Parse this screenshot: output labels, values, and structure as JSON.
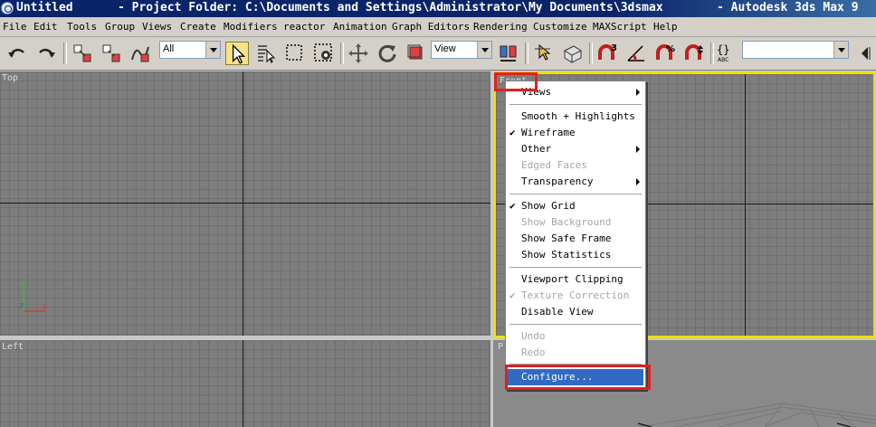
{
  "window": {
    "title_doc": "Untitled",
    "title_project": "- Project Folder: C:\\Documents and Settings\\Administrator\\My Documents\\3dsmax",
    "title_app": "- Autodesk 3ds Max 9"
  },
  "menubar": {
    "items": [
      "File",
      "Edit",
      "Tools",
      "Group",
      "Views",
      "Create",
      "Modifiers",
      "reactor",
      "Animation",
      "Graph Editors",
      "Rendering",
      "Customize",
      "MAXScript",
      "Help"
    ]
  },
  "toolbar": {
    "selection_filter": "All",
    "reference_coord": "View",
    "named_selection": ""
  },
  "viewports": {
    "top_left": "Top",
    "top_right": "Front",
    "bottom_left": "Left",
    "bottom_right": "P"
  },
  "axis_gizmo": {
    "y": "y",
    "z": "z",
    "x": "x"
  },
  "context_menu": {
    "items": [
      {
        "label": "Views",
        "submenu": true,
        "checked": false,
        "disabled": false
      },
      {
        "label": "Smooth + Highlights",
        "submenu": false,
        "checked": false,
        "disabled": false
      },
      {
        "label": "Wireframe",
        "submenu": false,
        "checked": true,
        "disabled": false
      },
      {
        "label": "Other",
        "submenu": true,
        "checked": false,
        "disabled": false
      },
      {
        "label": "Edged Faces",
        "submenu": false,
        "checked": false,
        "disabled": true
      },
      {
        "label": "Transparency",
        "submenu": true,
        "checked": false,
        "disabled": false
      },
      {
        "label": "Show Grid",
        "submenu": false,
        "checked": true,
        "disabled": false
      },
      {
        "label": "Show Background",
        "submenu": false,
        "checked": false,
        "disabled": true
      },
      {
        "label": "Show Safe Frame",
        "submenu": false,
        "checked": false,
        "disabled": false
      },
      {
        "label": "Show Statistics",
        "submenu": false,
        "checked": false,
        "disabled": false
      },
      {
        "label": "Viewport Clipping",
        "submenu": false,
        "checked": false,
        "disabled": false
      },
      {
        "label": "Texture Correction",
        "submenu": false,
        "checked": true,
        "disabled": true
      },
      {
        "label": "Disable View",
        "submenu": false,
        "checked": false,
        "disabled": false
      },
      {
        "label": "Undo",
        "submenu": false,
        "checked": false,
        "disabled": true
      },
      {
        "label": "Redo",
        "submenu": false,
        "checked": false,
        "disabled": true
      },
      {
        "label": "Configure...",
        "submenu": false,
        "checked": false,
        "disabled": false,
        "highlighted": true
      }
    ],
    "check_glyph": "✔"
  },
  "colors": {
    "titlebar": "#0a246a",
    "menu_highlight": "#316ac5",
    "active_viewport_border": "#f0e000",
    "annotation_red": "#e02020"
  }
}
